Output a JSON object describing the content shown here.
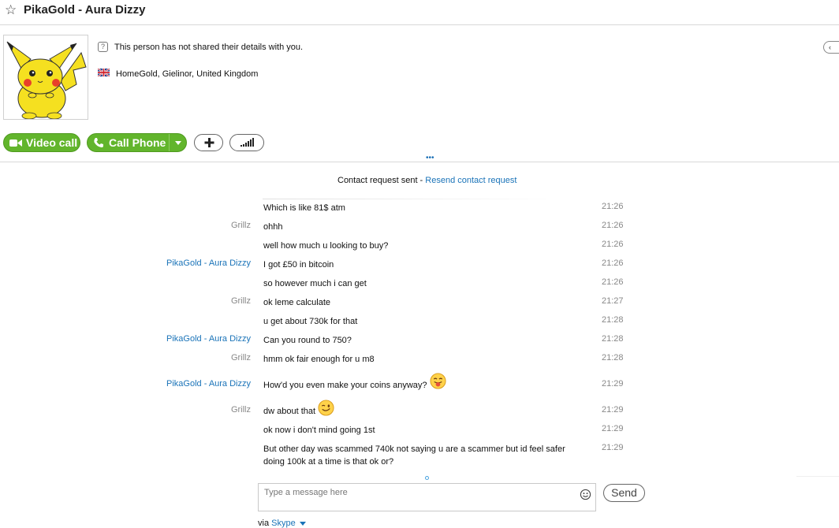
{
  "window": {
    "title": "PikaGold - Aura Dizzy"
  },
  "profile": {
    "privacy_note": "This person has not shared their details with you.",
    "location": "HomeGold, Gielinor, United Kingdom"
  },
  "actions": {
    "video_call_label": "Video call",
    "call_phone_label": "Call Phone"
  },
  "chat": {
    "contact_request_text": "Contact request sent - ",
    "resend_link": "Resend contact request",
    "messages": [
      {
        "sender": "",
        "text": "Which is like 81$ atm",
        "time": "21:26"
      },
      {
        "sender": "Grillz",
        "text": "ohhh",
        "time": "21:26"
      },
      {
        "sender": "",
        "text": "well how much u looking to buy?",
        "time": "21:26"
      },
      {
        "sender": "PikaGold - Aura Dizzy",
        "text": "I got £50 in bitcoin",
        "time": "21:26"
      },
      {
        "sender": "",
        "text": "so however much i can get",
        "time": "21:26"
      },
      {
        "sender": "Grillz",
        "text": "ok leme calculate",
        "time": "21:27"
      },
      {
        "sender": "",
        "text": "u get about 730k for that",
        "time": "21:28"
      },
      {
        "sender": "PikaGold - Aura Dizzy",
        "text": "Can you round to 750?",
        "time": "21:28"
      },
      {
        "sender": "Grillz",
        "text": "hmm ok fair enough for u m8",
        "time": "21:28"
      },
      {
        "sender": "PikaGold - Aura Dizzy",
        "text": "How'd you even make your coins anyway?",
        "time": "21:29",
        "emoji": "tongue-out-emoji"
      },
      {
        "sender": "Grillz",
        "text": "dw about that",
        "time": "21:29",
        "emoji": "wink-emoji"
      },
      {
        "sender": "",
        "text": "ok now i don't mind going 1st",
        "time": "21:29"
      },
      {
        "sender": "",
        "text": "But other day was scammed 740k not saying u are a scammer but id feel safer doing 100k at a time is that ok or?",
        "time": "21:29"
      }
    ]
  },
  "composer": {
    "placeholder": "Type a message here",
    "send_label": "Send",
    "via_prefix": "via ",
    "via_link": "Skype"
  },
  "colors": {
    "accent_green": "#62b52c",
    "link_blue": "#1a73b8",
    "sender_grey": "#888888"
  }
}
